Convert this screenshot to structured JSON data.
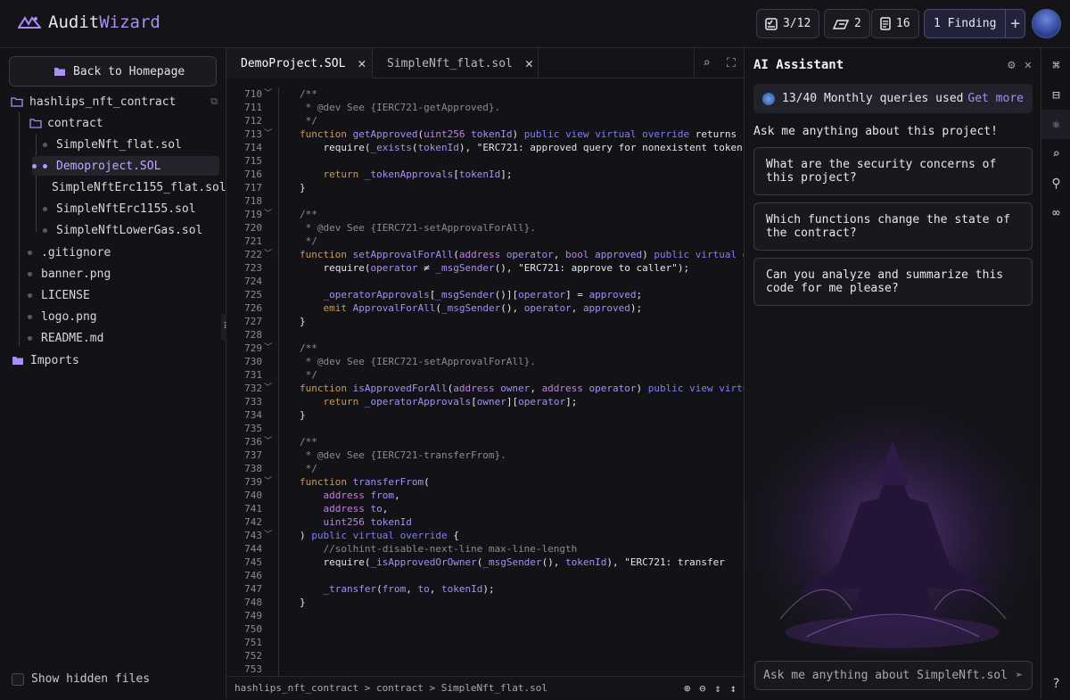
{
  "app": {
    "name_part1": "Audit",
    "name_part2": "Wizard"
  },
  "header": {
    "stats": [
      {
        "icon": "checklist-icon",
        "value": "3/12"
      },
      {
        "icon": "contract-icon",
        "value": "2"
      },
      {
        "icon": "document-icon",
        "value": "16"
      }
    ],
    "finding_label": "1 Finding",
    "add_symbol": "+"
  },
  "sidebar": {
    "back_label": "Back to Homepage",
    "root": "hashlips_nft_contract",
    "folder": "contract",
    "files": [
      "SimpleNft_flat.sol",
      "Demoproject.SOL",
      "SimpleNftErc1155_flat.sol",
      "SimpleNftErc1155.sol",
      "SimpleNftLowerGas.sol"
    ],
    "root_files": [
      ".gitignore",
      "banner.png",
      "LICENSE",
      "logo.png",
      "README.md"
    ],
    "imports": "Imports",
    "show_hidden": "Show hidden files"
  },
  "editor": {
    "tabs": [
      {
        "label": "DemoProject.SOL",
        "active": true
      },
      {
        "label": "SimpleNft_flat.sol",
        "active": false
      }
    ],
    "breadcrumb": "hashlips_nft_contract > contract > SimpleNft_flat.sol",
    "line_start": 710,
    "fold_lines": [
      710,
      713,
      719,
      722,
      729,
      732,
      736,
      739,
      743
    ],
    "lines": [
      "/**",
      " * @dev See {IERC721-getApproved}.",
      " */",
      "function getApproved(uint256 tokenId) public view virtual override returns (add",
      "    require(_exists(tokenId), \"ERC721: approved query for nonexistent token\");",
      "",
      "    return _tokenApprovals[tokenId];",
      "}",
      "",
      "/**",
      " * @dev See {IERC721-setApprovalForAll}.",
      " */",
      "function setApprovalForAll(address operator, bool approved) public virtual over",
      "    require(operator ≠ _msgSender(), \"ERC721: approve to caller\");",
      "",
      "    _operatorApprovals[_msgSender()][operator] = approved;",
      "    emit ApprovalForAll(_msgSender(), operator, approved);",
      "}",
      "",
      "/**",
      " * @dev See {IERC721-setApprovalForAll}.",
      " */",
      "function isApprovedForAll(address owner, address operator) public view virtual",
      "    return _operatorApprovals[owner][operator];",
      "}",
      "",
      "/**",
      " * @dev See {IERC721-transferFrom}.",
      " */",
      "function transferFrom(",
      "    address from,",
      "    address to,",
      "    uint256 tokenId",
      ") public virtual override {",
      "    //solhint-disable-next-line max-line-length",
      "    require(_isApprovedOrOwner(_msgSender(), tokenId), \"ERC721: transfer",
      "",
      "    _transfer(from, to, tokenId);",
      "}",
      "",
      "",
      "",
      "",
      "",
      ""
    ]
  },
  "ai": {
    "title": "AI Assistant",
    "quota": "13/40 Monthly queries used",
    "get_more": "Get more",
    "prompt": "Ask me anything about this project!",
    "suggestions": [
      "What are the security concerns of this project?",
      "Which functions change the state of the contract?",
      "Can you analyze and summarize this code for me please?"
    ],
    "input_placeholder": "Ask me anything about SimpleNft.sol"
  },
  "rail": [
    "graph-icon",
    "scan-icon",
    "ai-icon",
    "search-code-icon",
    "tree-icon",
    "binoculars-icon",
    "help-icon"
  ]
}
